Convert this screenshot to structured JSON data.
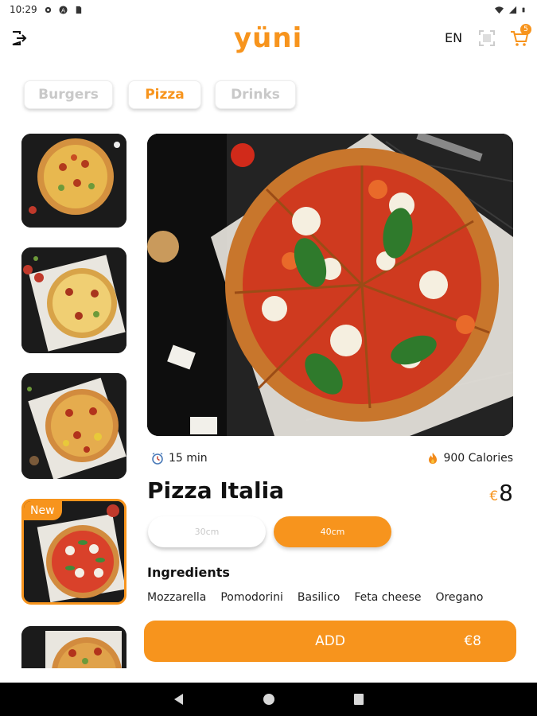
{
  "status_bar": {
    "time": "10:29",
    "icons": [
      "settings-icon",
      "a-circle-icon",
      "sim-icon",
      "wifi-icon",
      "signal-icon",
      "battery-icon"
    ]
  },
  "header": {
    "logo_text": "yüni",
    "language": "EN",
    "cart_count": "5",
    "accent_color": "#f7941d"
  },
  "tabs": [
    {
      "label": "Burgers",
      "active": false
    },
    {
      "label": "Pizza",
      "active": true
    },
    {
      "label": "Drinks",
      "active": false
    }
  ],
  "thumbnails": [
    {
      "name": "pizza-1",
      "badge": ""
    },
    {
      "name": "pizza-2",
      "badge": ""
    },
    {
      "name": "pizza-3",
      "badge": ""
    },
    {
      "name": "pizza-4",
      "badge": "New",
      "selected": true
    },
    {
      "name": "pizza-5",
      "badge": ""
    }
  ],
  "product": {
    "time": "15 min",
    "calories": "900 Calories",
    "name": "Pizza Italia",
    "currency": "€",
    "price": "8",
    "sizes": [
      {
        "label": "30cm",
        "selected": false
      },
      {
        "label": "40cm",
        "selected": true
      }
    ],
    "ingredients_title": "Ingredients",
    "ingredients": [
      "Mozzarella",
      "Pomodorini",
      "Basilico",
      "Feta cheese",
      "Oregano"
    ]
  },
  "add_button": {
    "label": "ADD",
    "price": "€8"
  },
  "nav": {
    "icons": [
      "back-icon",
      "home-icon",
      "recents-icon"
    ]
  }
}
